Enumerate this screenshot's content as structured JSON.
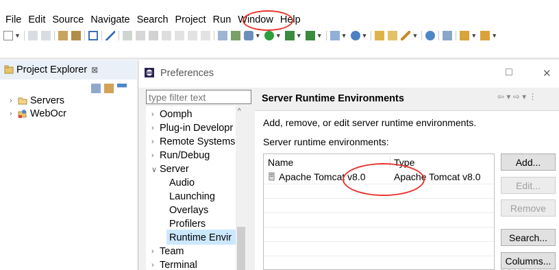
{
  "menu": {
    "items": [
      "File",
      "Edit",
      "Source",
      "Navigate",
      "Search",
      "Project",
      "Run",
      "Window",
      "Help"
    ]
  },
  "toolbar": {
    "icons": [
      "new-icon",
      "save-icon",
      "save-all-icon",
      "open-type-icon",
      "open-resource-icon",
      "console-icon",
      "pen-icon",
      "resume-icon",
      "suspend-icon",
      "terminate-icon",
      "disconnect-icon",
      "step-into-icon",
      "step-over-icon",
      "step-return-icon",
      "drop-to-frame-icon",
      "use-step-filters-icon",
      "debug-icon",
      "run-icon",
      "server-icon",
      "new-server-icon",
      "new-java-project-icon",
      "new-package-icon",
      "new-class-icon",
      "open-folder-icon",
      "open-task-icon",
      "pencil-icon",
      "web-browser-icon",
      "search-icon",
      "next-annotation-icon",
      "previous-annotation-icon"
    ]
  },
  "project_explorer": {
    "title": "Project Explorer",
    "close_symbol": "⊠",
    "items": [
      {
        "label": "Servers"
      },
      {
        "label": "WebOcr"
      }
    ]
  },
  "dialog": {
    "title": "Preferences",
    "maximize_symbol": "□",
    "close_symbol": "✕",
    "filter_placeholder": "type filter text",
    "tree": [
      {
        "label": "Oomph",
        "expander": "›"
      },
      {
        "label": "Plug-in Developr",
        "expander": "›"
      },
      {
        "label": "Remote Systems",
        "expander": "›"
      },
      {
        "label": "Run/Debug",
        "expander": "›"
      },
      {
        "label": "Server",
        "expander": "∨"
      },
      {
        "label": "Audio",
        "expander": ""
      },
      {
        "label": "Launching",
        "expander": ""
      },
      {
        "label": "Overlays",
        "expander": ""
      },
      {
        "label": "Profilers",
        "expander": ""
      },
      {
        "label": "Runtime Envir",
        "expander": ""
      },
      {
        "label": "Team",
        "expander": "›"
      },
      {
        "label": "Terminal",
        "expander": "›"
      }
    ],
    "page": {
      "title": "Server Runtime Environments",
      "nav_symbols": "⇦ ▾ ⇨ ▾ ⋮",
      "description": "Add, remove, or edit server runtime environments.",
      "list_label": "Server runtime environments:",
      "table": {
        "headers": [
          "Name",
          "Type"
        ],
        "rows": [
          {
            "name": "Apache Tomcat v8.0",
            "type": "Apache Tomcat v8.0"
          }
        ]
      },
      "buttons": {
        "add": "Add...",
        "edit": "Edit...",
        "remove": "Remove",
        "search": "Search...",
        "columns": "Columns..."
      }
    }
  },
  "colors": {
    "highlight_ring": "#e8332e",
    "selection": "#cce8ff",
    "view_tab": "#e9f0f8"
  }
}
